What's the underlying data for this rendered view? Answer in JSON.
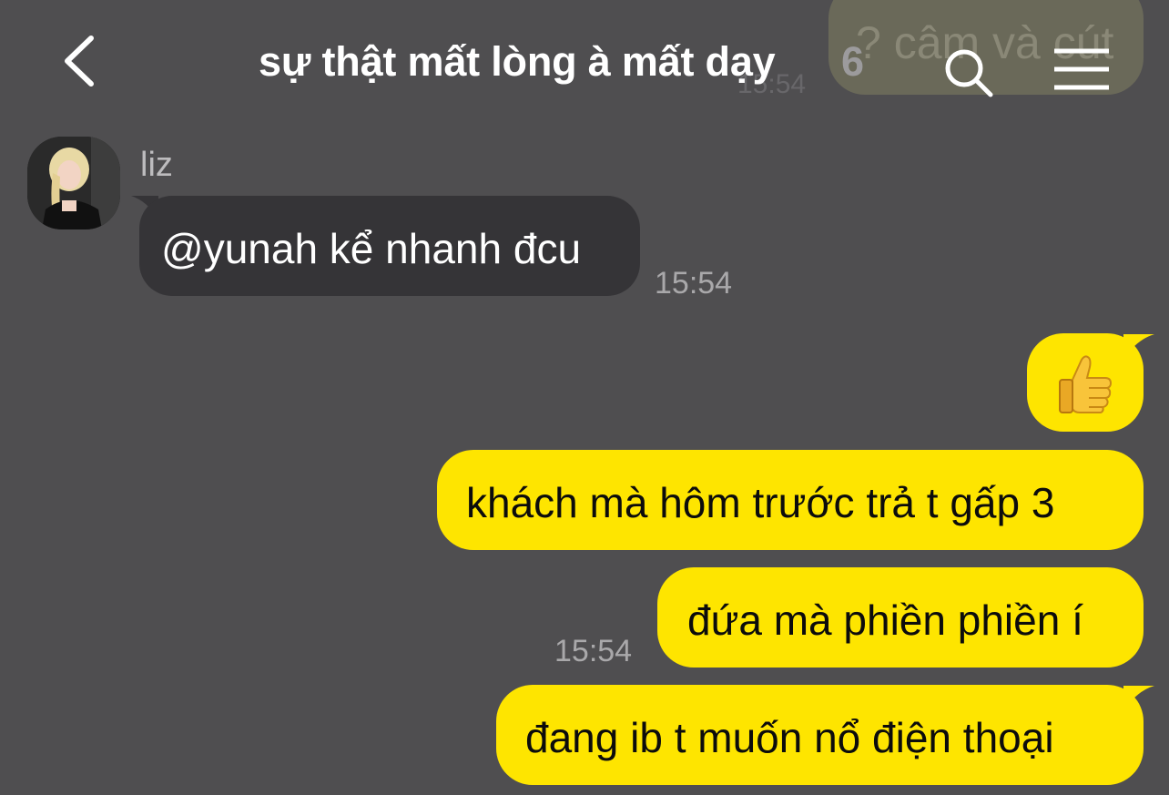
{
  "header": {
    "title": "sự thật mất lòng à mất dạy",
    "member_count": "6"
  },
  "ghost": {
    "text": "? câm và cút",
    "time": "15:54"
  },
  "incoming": {
    "sender": "liz",
    "message": "@yunah kể nhanh đcu",
    "time": "15:54"
  },
  "outgoing": {
    "reaction_emoji": "thumbs-up",
    "messages": [
      "khách mà hôm trước trả t gấp 3",
      "đứa mà phiền phiền í",
      "đang ib t muốn nổ điện thoại"
    ],
    "time": "15:54"
  },
  "colors": {
    "background": "#4f4e50",
    "outgoing_bubble": "#fee500",
    "incoming_bubble": "#353437"
  }
}
